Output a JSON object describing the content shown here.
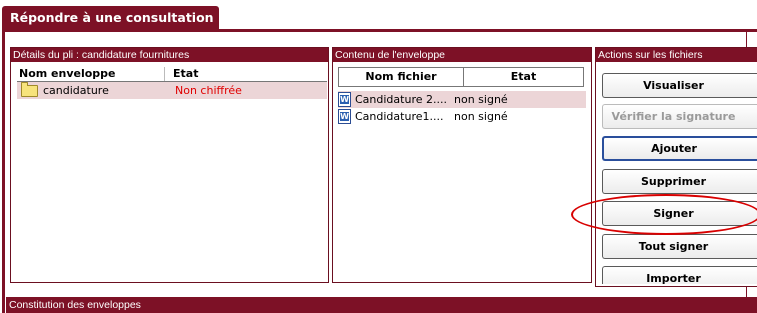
{
  "page": {
    "title": "Répondre à une consultation"
  },
  "details_panel": {
    "title": "Détails du pli : candidature fournitures",
    "columns": [
      "Nom enveloppe",
      "Etat"
    ],
    "rows": [
      {
        "name": "candidature",
        "state": "Non chiffrée",
        "icon": "folder-icon"
      }
    ]
  },
  "content_panel": {
    "title": "Contenu de l'enveloppe",
    "columns": [
      "Nom fichier",
      "Etat"
    ],
    "rows": [
      {
        "name": "Candidature 2....",
        "state": "non signé",
        "icon": "word-document-icon"
      },
      {
        "name": "Candidature1....",
        "state": "non signé",
        "icon": "word-document-icon"
      }
    ]
  },
  "actions_panel": {
    "title": "Actions sur les fichiers",
    "buttons": {
      "visualiser": "Visualiser",
      "verifier": "Vérifier la signature",
      "ajouter": "Ajouter",
      "supprimer": "Supprimer",
      "signer": "Signer",
      "tout_signer": "Tout signer",
      "importer": "Importer"
    }
  },
  "bottom_section": {
    "title": "Constitution des enveloppes"
  },
  "colors": {
    "brand": "#7d1126",
    "selected_row": "#ecd5d7",
    "status_red": "#e00000",
    "annotation": "#d80000"
  }
}
